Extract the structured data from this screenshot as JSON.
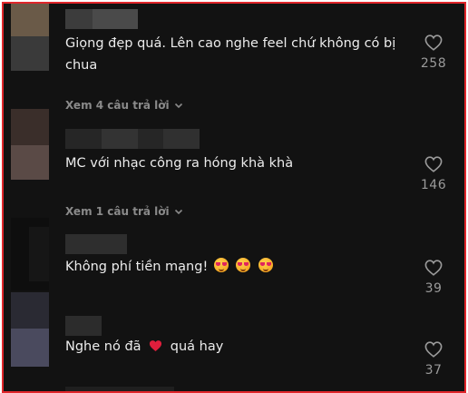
{
  "comments": [
    {
      "text": "Giọng đẹp quá. Lên cao nghe feel chứ không có bị chua",
      "likes": "258",
      "replies_label": "Xem 4 câu trả lời"
    },
    {
      "text": "MC với nhạc công ra hóng khà khà",
      "likes": "146",
      "replies_label": "Xem 1 câu trả lời"
    },
    {
      "text": "Không phí tiền mạng!",
      "emojis": [
        "smiling-face-with-heart-eyes",
        "smiling-face-with-heart-eyes",
        "smiling-face-with-heart-eyes"
      ],
      "likes": "39"
    },
    {
      "text_before": "Nghe nó đã",
      "inline_icon": "red-heart",
      "text_after": "quá hay",
      "likes": "37"
    }
  ],
  "colors": {
    "frame_border": "#e0262b",
    "background": "#121212",
    "text": "#ececec",
    "muted": "#8a8a8a",
    "heart": "#e0245e"
  }
}
